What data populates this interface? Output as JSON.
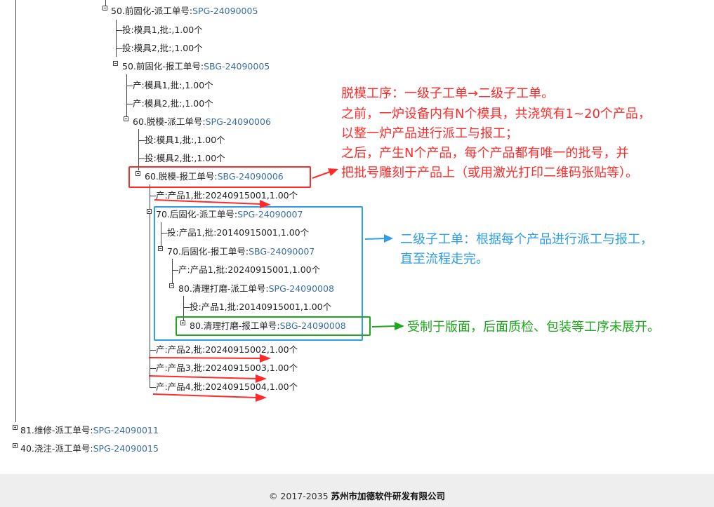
{
  "tree": {
    "nodes": [
      {
        "id": "n1",
        "prefix": "50.前固化-派工单号:",
        "code": "SPG-24090005"
      },
      {
        "id": "n2",
        "prefix": "投:模具1,批:,1.00个",
        "code": ""
      },
      {
        "id": "n3",
        "prefix": "投:模具2,批:,1.00个",
        "code": ""
      },
      {
        "id": "n4",
        "prefix": "50.前固化-报工单号:",
        "code": "SBG-24090005"
      },
      {
        "id": "n5",
        "prefix": "产:模具1,批:,1.00个",
        "code": ""
      },
      {
        "id": "n6",
        "prefix": "产:模具2,批:,1.00个",
        "code": ""
      },
      {
        "id": "n7",
        "prefix": "60.脱模-派工单号:",
        "code": "SPG-24090006"
      },
      {
        "id": "n8",
        "prefix": "投:模具1,批:,1.00个",
        "code": ""
      },
      {
        "id": "n9",
        "prefix": "投:模具2,批:,1.00个",
        "code": ""
      },
      {
        "id": "n10",
        "prefix": "60.脱模-报工单号:",
        "code": "SBG-24090006"
      },
      {
        "id": "n11",
        "prefix": "产:产品1,批:20240915001,1.00个",
        "code": ""
      },
      {
        "id": "n12",
        "prefix": "70.后固化-派工单号:",
        "code": "SPG-24090007"
      },
      {
        "id": "n13",
        "prefix": "投:产品1,批:20140915001,1.00个",
        "code": ""
      },
      {
        "id": "n14",
        "prefix": "70.后固化-报工单号:",
        "code": "SBG-24090007"
      },
      {
        "id": "n15",
        "prefix": "产:产品1,批:20240915001,1.00个",
        "code": ""
      },
      {
        "id": "n16",
        "prefix": "80.清理打磨-派工单号:",
        "code": "SPG-24090008"
      },
      {
        "id": "n17",
        "prefix": "投:产品1,批:20140915001,1.00个",
        "code": ""
      },
      {
        "id": "n18",
        "prefix": "80.清理打磨-报工单号:",
        "code": "SBG-24090008"
      },
      {
        "id": "n19",
        "prefix": "产:产品2,批:20240915002,1.00个",
        "code": ""
      },
      {
        "id": "n20",
        "prefix": "产:产品3,批:20240915003,1.00个",
        "code": ""
      },
      {
        "id": "n21",
        "prefix": "产:产品4,批:20240915004,1.00个",
        "code": ""
      },
      {
        "id": "n22",
        "prefix": "81.维修-派工单号:",
        "code": "SPG-24090011"
      },
      {
        "id": "n23",
        "prefix": "40.浇注-派工单号:",
        "code": "SPG-24090015"
      }
    ]
  },
  "annotations": {
    "red": [
      "脱模工序：一级子工单→二级子工单。",
      "之前，一炉设备内有N个模具，共浇筑有1~20个产品，",
      "以整一炉产品进行派工与报工；",
      "之后，产生N个产品，每个产品都有唯一的批号，并",
      "把批号雕刻于产品上（或用激光打印二维码张贴等）。"
    ],
    "blue": [
      "二级子工单：根据每个产品进行派工与报工，",
      "直至流程走完。"
    ],
    "green": [
      "受制于版面，后面质检、包装等工序未展开。"
    ]
  },
  "colors": {
    "red": "#ff2b2b",
    "blue": "#2f9ee8",
    "green": "#1fa81f",
    "link": "#3a6ea5"
  },
  "footer": {
    "copyright": "© 2017-2035",
    "company": "苏州市加德软件研发有限公司"
  }
}
